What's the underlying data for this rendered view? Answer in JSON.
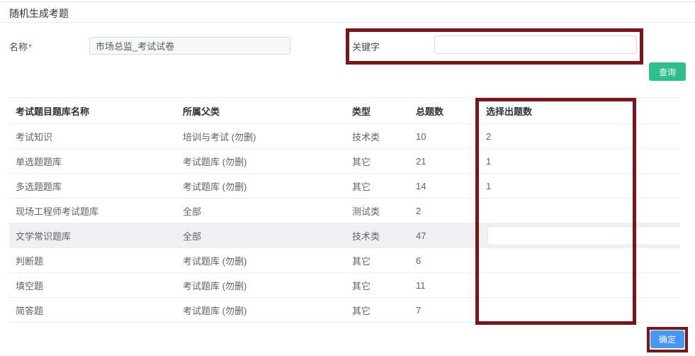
{
  "page": {
    "title": "随机生成考题"
  },
  "form": {
    "name_label": "名称",
    "required_mark": "*",
    "name_value": "市场总监_考试试卷",
    "keyword_label": "关键字",
    "keyword_value": "",
    "query_button": "查询"
  },
  "table": {
    "headers": [
      "考试题目题库名称",
      "所属父类",
      "类型",
      "总题数",
      "选择出题数"
    ],
    "rows": [
      {
        "name": "考试知识",
        "parent": "培训与考试 (勿删)",
        "type": "技术类",
        "total": "10",
        "selected": "2",
        "highlighted": false,
        "has_input": false
      },
      {
        "name": "单选题题库",
        "parent": "考试题库 (勿删)",
        "type": "其它",
        "total": "21",
        "selected": "1",
        "highlighted": false,
        "has_input": false
      },
      {
        "name": "多选题题库",
        "parent": "考试题库 (勿删)",
        "type": "其它",
        "total": "14",
        "selected": "1",
        "highlighted": false,
        "has_input": false
      },
      {
        "name": "现场工程师考试题库",
        "parent": "全部",
        "type": "测试类",
        "total": "2",
        "selected": "",
        "highlighted": false,
        "has_input": false
      },
      {
        "name": "文学常识题库",
        "parent": "全部",
        "type": "技术类",
        "total": "47",
        "selected": "",
        "highlighted": true,
        "has_input": true
      },
      {
        "name": "判断题",
        "parent": "考试题库 (勿删)",
        "type": "其它",
        "total": "6",
        "selected": "",
        "highlighted": false,
        "has_input": false
      },
      {
        "name": "填空题",
        "parent": "考试题库 (勿删)",
        "type": "其它",
        "total": "11",
        "selected": "",
        "highlighted": false,
        "has_input": false
      },
      {
        "name": "简答题",
        "parent": "考试题库 (勿删)",
        "type": "其它",
        "total": "7",
        "selected": "",
        "highlighted": false,
        "has_input": false
      }
    ]
  },
  "footer": {
    "confirm_button": "确定"
  },
  "colors": {
    "annotation": "#7d1518",
    "query_green": "#2fbe8e",
    "confirm_blue": "#4498f4",
    "row_highlight": "#eff0f4"
  }
}
